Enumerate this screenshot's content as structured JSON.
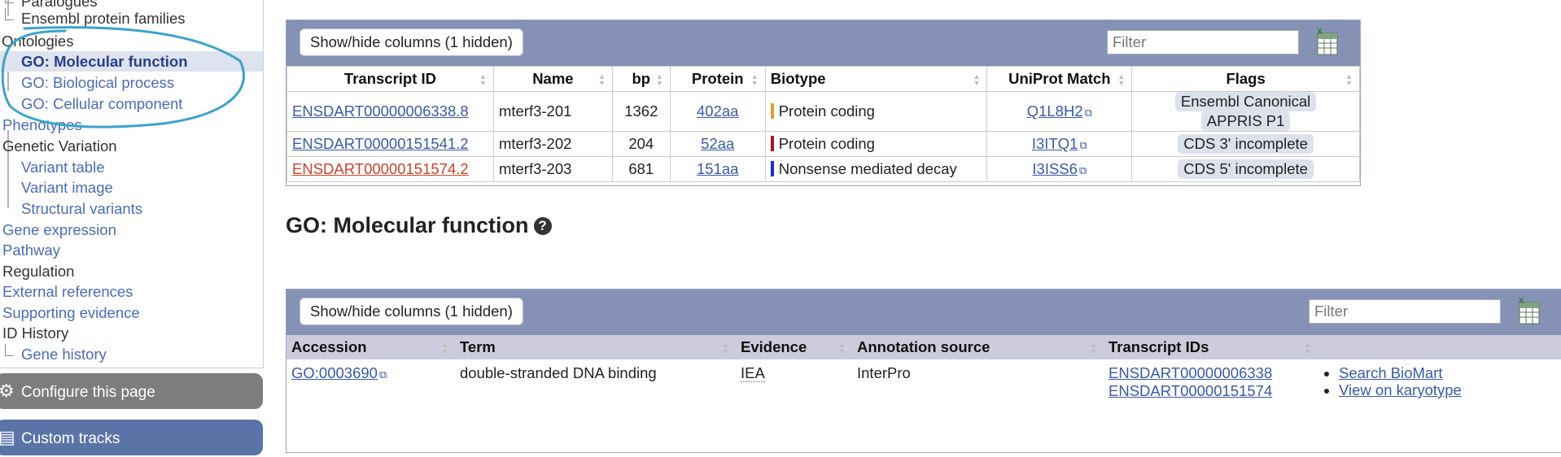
{
  "leftnav": {
    "items": [
      {
        "label": "Paralogues",
        "type": "sub-link"
      },
      {
        "label": "Ensembl protein families",
        "type": "sub-plain"
      },
      {
        "label": "Ontologies",
        "type": "plain"
      },
      {
        "label": "GO: Molecular function",
        "type": "sub-active"
      },
      {
        "label": "GO: Biological process",
        "type": "sub-link"
      },
      {
        "label": "GO: Cellular component",
        "type": "sub-link"
      },
      {
        "label": "Phenotypes",
        "type": "link"
      },
      {
        "label": "Genetic Variation",
        "type": "plain"
      },
      {
        "label": "Variant table",
        "type": "sub-link"
      },
      {
        "label": "Variant image",
        "type": "sub-link"
      },
      {
        "label": "Structural variants",
        "type": "sub-link"
      },
      {
        "label": "Gene expression",
        "type": "link"
      },
      {
        "label": "Pathway",
        "type": "link"
      },
      {
        "label": "Regulation",
        "type": "plain"
      },
      {
        "label": "External references",
        "type": "link"
      },
      {
        "label": "Supporting evidence",
        "type": "link"
      },
      {
        "label": "ID History",
        "type": "plain"
      },
      {
        "label": "Gene history",
        "type": "sub-link"
      }
    ],
    "configure_label": "Configure this page",
    "custom_tracks_label": "Custom tracks",
    "annotation_color": "#3ba3cc"
  },
  "transcripts": {
    "show_hide_label": "Show/hide columns (1 hidden)",
    "filter_placeholder": "Filter",
    "columns": [
      "Transcript ID",
      "Name",
      "bp",
      "Protein",
      "Biotype",
      "UniProt Match",
      "Flags"
    ],
    "rows": [
      {
        "id": "ENSDART00000006338.8",
        "name": "mterf3-201",
        "bp": "1362",
        "protein": "402aa",
        "biotype": "Protein coding",
        "biotype_color": "#d4a33a",
        "uniprot": "Q1L8H2",
        "flags": [
          "Ensembl Canonical",
          "APPRIS P1"
        ],
        "id_color": "#3a5aa8"
      },
      {
        "id": "ENSDART00000151541.2",
        "name": "mterf3-202",
        "bp": "204",
        "protein": "52aa",
        "biotype": "Protein coding",
        "biotype_color": "#a8191d",
        "uniprot": "I3ITQ1",
        "flags": [
          "CDS 3' incomplete"
        ],
        "id_color": "#3a5aa8"
      },
      {
        "id": "ENSDART00000151574.2",
        "name": "mterf3-203",
        "bp": "681",
        "protein": "151aa",
        "biotype": "Nonsense mediated decay",
        "biotype_color": "#1a2fd6",
        "uniprot": "I3ISS6",
        "flags": [
          "CDS 5' incomplete"
        ],
        "id_color": "#c8442a"
      }
    ]
  },
  "go_section": {
    "heading": "GO: Molecular function",
    "show_hide_label": "Show/hide columns (1 hidden)",
    "filter_placeholder": "Filter",
    "columns": [
      "Accession",
      "Term",
      "Evidence",
      "Annotation source",
      "Transcript IDs"
    ],
    "rows": [
      {
        "accession": "GO:0003690",
        "term": "double-stranded DNA binding",
        "evidence": "IEA",
        "source": "InterPro",
        "transcripts": [
          "ENSDART00000006338",
          "ENSDART00000151574"
        ],
        "links": [
          "Search BioMart",
          "View on karyotype"
        ]
      }
    ]
  }
}
